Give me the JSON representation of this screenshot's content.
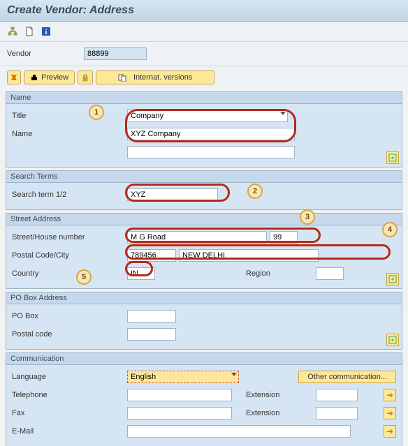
{
  "page_title": "Create Vendor: Address",
  "vendor": {
    "label": "Vendor",
    "value": "88899"
  },
  "actions": {
    "preview": "Preview",
    "internat_versions": "Internat. versions"
  },
  "name_panel": {
    "legend": "Name",
    "title_label": "Title",
    "title_value": "Company",
    "name_label": "Name",
    "name_value": "XYZ Company"
  },
  "search_panel": {
    "legend": "Search Terms",
    "search_label": "Search term 1/2",
    "search_value": "XYZ"
  },
  "street_panel": {
    "legend": "Street Address",
    "street_label": "Street/House number",
    "street_value": "M G Road",
    "house_value": "99",
    "postal_label": "Postal Code/City",
    "postal_value": "789456",
    "city_value": "NEW DELHI",
    "country_label": "Country",
    "country_value": "IN",
    "region_label": "Region",
    "region_value": ""
  },
  "pobox_panel": {
    "legend": "PO Box Address",
    "pobox_label": "PO Box",
    "pobox_value": "",
    "postal_label": "Postal code",
    "postal_value": ""
  },
  "comm_panel": {
    "legend": "Communication",
    "language_label": "Language",
    "language_value": "English",
    "other_comm": "Other communication...",
    "telephone_label": "Telephone",
    "telephone_value": "",
    "fax_label": "Fax",
    "fax_value": "",
    "ext_label": "Extension",
    "ext1_value": "",
    "ext2_value": "",
    "email_label": "E-Mail",
    "email_value": ""
  },
  "annotations": [
    "1",
    "2",
    "3",
    "4",
    "5"
  ]
}
